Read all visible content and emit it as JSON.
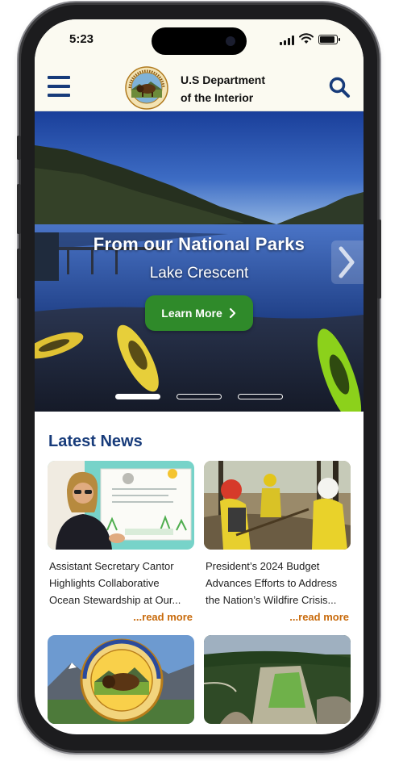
{
  "status_bar": {
    "time": "5:23",
    "icons": [
      "cellular-signal-icon",
      "wifi-icon",
      "battery-icon"
    ]
  },
  "header": {
    "menu_icon": "hamburger-menu-icon",
    "logo_icon": "doi-seal-logo",
    "agency_line1": "U.S Department",
    "agency_line2": "of the Interior",
    "search_icon": "search-icon",
    "brand_color": "#173b7a"
  },
  "hero": {
    "title": "From our National Parks",
    "subtitle": "Lake Crescent",
    "cta_label": "Learn More",
    "cta_color": "#2f8a2a",
    "slides_total": 3,
    "active_slide": 1
  },
  "news": {
    "heading": "Latest News",
    "read_more_color": "#c86a0b",
    "items": [
      {
        "line1": "Assistant Secretary Cantor",
        "line2": "Highlights Collaborative",
        "line3": "Ocean Stewardship at Our...",
        "read_more": "...read more"
      },
      {
        "line1": "President’s 2024 Budget",
        "line2": "Advances Efforts to Address",
        "line3": "the Nation’s Wildfire Crisis...",
        "read_more": "...read more"
      }
    ]
  }
}
